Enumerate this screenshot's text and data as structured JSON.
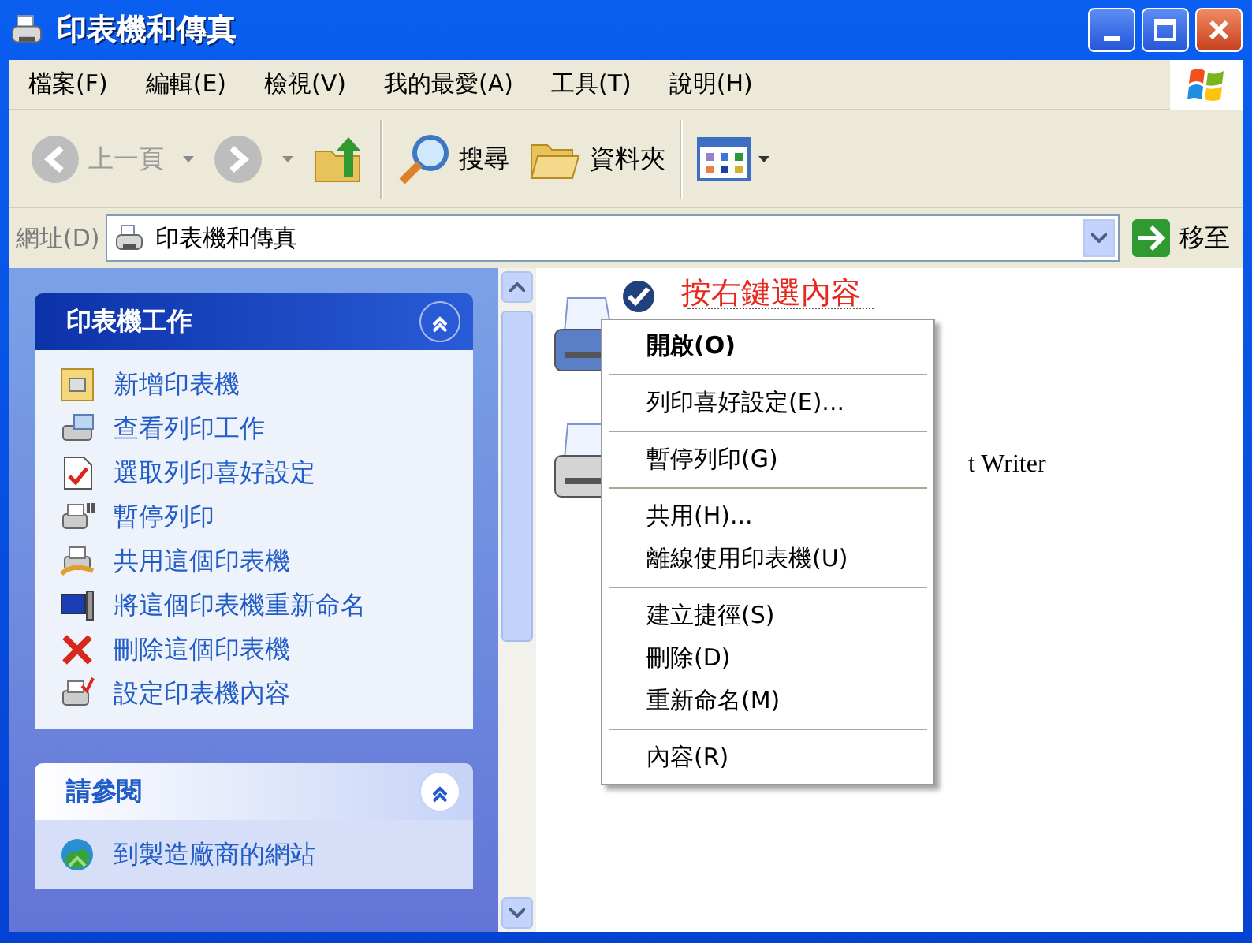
{
  "window": {
    "title": "印表機和傳真"
  },
  "menu_bar": [
    "檔案(F)",
    "編輯(E)",
    "檢視(V)",
    "我的最愛(A)",
    "工具(T)",
    "說明(H)"
  ],
  "toolbar": [
    {
      "kind": "back",
      "label": "上一頁",
      "disabled": true
    },
    {
      "kind": "forward",
      "disabled": true
    },
    {
      "kind": "up"
    },
    {
      "kind": "separator"
    },
    {
      "kind": "search",
      "label": "搜尋"
    },
    {
      "kind": "folders",
      "label": "資料夾"
    },
    {
      "kind": "separator"
    },
    {
      "kind": "views"
    }
  ],
  "address_bar": {
    "label": "網址(D)",
    "value": "印表機和傳真",
    "go": "移至"
  },
  "task_panels": [
    {
      "title": "印表機工作",
      "kind": "special",
      "expanded": true,
      "items": [
        {
          "label": "新增印表機"
        },
        {
          "label": "查看列印工作"
        },
        {
          "label": "選取列印喜好設定"
        },
        {
          "label": "暫停列印"
        },
        {
          "label": "共用這個印表機"
        },
        {
          "label": "將這個印表機重新命名"
        },
        {
          "label": "刪除這個印表機"
        },
        {
          "label": "設定印表機內容"
        }
      ]
    },
    {
      "title": "請參閱",
      "kind": "normal",
      "expanded": true,
      "items": [
        {
          "label": "到製造廠商的網站"
        }
      ]
    }
  ],
  "printers": [
    {
      "default": true,
      "selected": true,
      "color": "#5b7fc7"
    },
    {
      "label": "t Writer",
      "default": false,
      "selected": false,
      "color": "#d4d4d4"
    }
  ],
  "annotation": "按右鍵選內容",
  "context_menu": [
    [
      {
        "label": "開啟(O)",
        "default": true
      }
    ],
    [
      {
        "label": "列印喜好設定(E)...",
        "default": false
      }
    ],
    [
      {
        "label": "暫停列印(G)",
        "default": false
      }
    ],
    [
      {
        "label": "共用(H)...",
        "default": false
      },
      {
        "label": "離線使用印表機(U)",
        "default": false
      }
    ],
    [
      {
        "label": "建立捷徑(S)",
        "default": false
      },
      {
        "label": "刪除(D)",
        "default": false
      },
      {
        "label": "重新命名(M)",
        "default": false
      }
    ],
    [
      {
        "label": "內容(R)",
        "default": false
      }
    ]
  ]
}
